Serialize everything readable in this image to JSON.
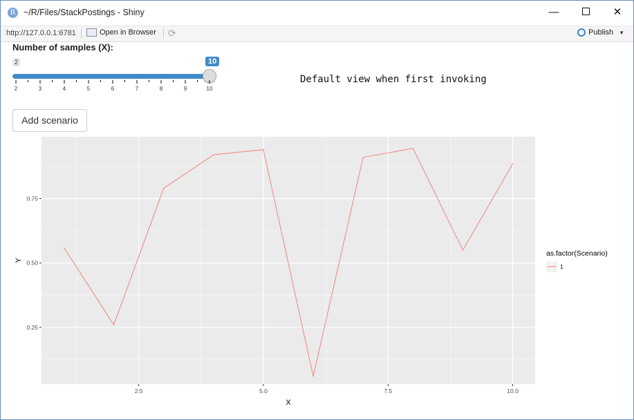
{
  "window": {
    "app_icon": "R",
    "title": "~/R/Files/StackPostings - Shiny"
  },
  "toolbar": {
    "url": "http://127.0.0.1:6781",
    "open_browser_label": "Open in Browser",
    "publish_label": "Publish"
  },
  "slider": {
    "label": "Number of samples (X):",
    "min": 2,
    "max": 10,
    "value": 10,
    "min_label": "2",
    "value_label": "10",
    "tick_labels": [
      "2",
      "3",
      "4",
      "5",
      "6",
      "7",
      "8",
      "9",
      "10"
    ]
  },
  "note": "Default view when first invoking",
  "add_button_label": "Add scenario",
  "colors": {
    "accent": "#428bca",
    "line": "#F8766D",
    "panel": "#EBEBEB"
  },
  "chart_data": {
    "type": "line",
    "xlabel": "X",
    "ylabel": "Y",
    "xlim": [
      0.55,
      10.45
    ],
    "ylim": [
      0.03,
      0.99
    ],
    "x_ticks": [
      2.5,
      5.0,
      7.5,
      10.0
    ],
    "x_tick_labels": [
      "2.5",
      "5.0",
      "7.5",
      "10.0"
    ],
    "y_ticks": [
      0.25,
      0.5,
      0.75
    ],
    "y_tick_labels": [
      "0.25",
      "0.50",
      "0.75"
    ],
    "legend_title": "as.factor(Scenario)",
    "legend_position": "right",
    "grid": true,
    "series": [
      {
        "name": "1",
        "x": [
          1,
          2,
          3,
          4,
          5,
          6,
          7,
          8,
          9,
          10
        ],
        "values": [
          0.56,
          0.26,
          0.79,
          0.92,
          0.94,
          0.06,
          0.91,
          0.945,
          0.55,
          0.885
        ]
      }
    ]
  }
}
